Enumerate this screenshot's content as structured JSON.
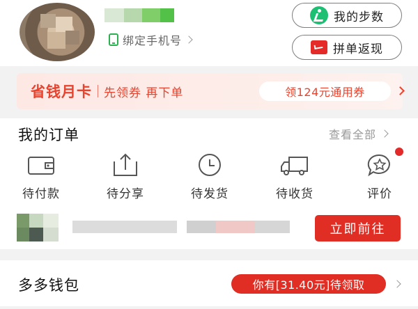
{
  "header": {
    "bind_phone_label": "绑定手机号",
    "steps_button": "我的步数",
    "group_refund_button": "拼单返现"
  },
  "saving_card": {
    "title": "省钱月卡",
    "subtitle": "先领券 再下单",
    "coupon": "领124元通用券"
  },
  "orders": {
    "title": "我的订单",
    "view_all": "查看全部",
    "items": [
      {
        "label": "待付款",
        "icon": "wallet-icon"
      },
      {
        "label": "待分享",
        "icon": "share-icon"
      },
      {
        "label": "待发货",
        "icon": "clock-icon"
      },
      {
        "label": "待收货",
        "icon": "truck-icon"
      },
      {
        "label": "评价",
        "icon": "review-icon"
      }
    ],
    "go_button": "立即前往"
  },
  "wallet": {
    "title": "多多钱包",
    "badge": "你有[31.40元]待领取"
  },
  "colors": {
    "brand_red": "#e02e24",
    "banner_text": "#e8432e",
    "green": "#2cb050"
  }
}
